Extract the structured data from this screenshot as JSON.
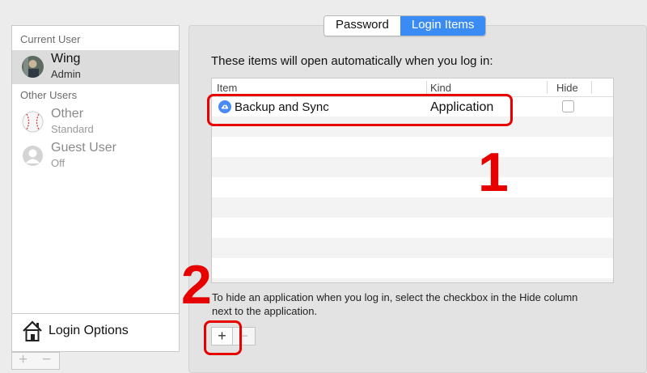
{
  "sidebar": {
    "current_user_heading": "Current User",
    "other_users_heading": "Other Users",
    "users": [
      {
        "name": "Wing",
        "role": "Admin"
      },
      {
        "name": "Other",
        "role": "Standard"
      },
      {
        "name": "Guest User",
        "role": "Off"
      }
    ],
    "login_options_label": "Login Options",
    "add_label": "+",
    "remove_label": "−"
  },
  "tabs": [
    {
      "label": "Password",
      "active": false
    },
    {
      "label": "Login Items",
      "active": true
    }
  ],
  "login_items": {
    "intro": "These items will open automatically when you log in:",
    "columns": {
      "item": "Item",
      "kind": "Kind",
      "hide": "Hide"
    },
    "rows": [
      {
        "item": "Backup and Sync",
        "kind": "Application",
        "hide": false,
        "icon": "cloud-icon"
      }
    ],
    "help_text": "To hide an application when you log in, select the checkbox in the Hide column next to the application.",
    "add_label": "+",
    "remove_label": "−"
  },
  "annotations": {
    "marker_1": "1",
    "marker_2": "2",
    "color": "#e60000"
  },
  "colors": {
    "accent": "#3a8cf4",
    "sync_icon": "#4a8af4"
  }
}
